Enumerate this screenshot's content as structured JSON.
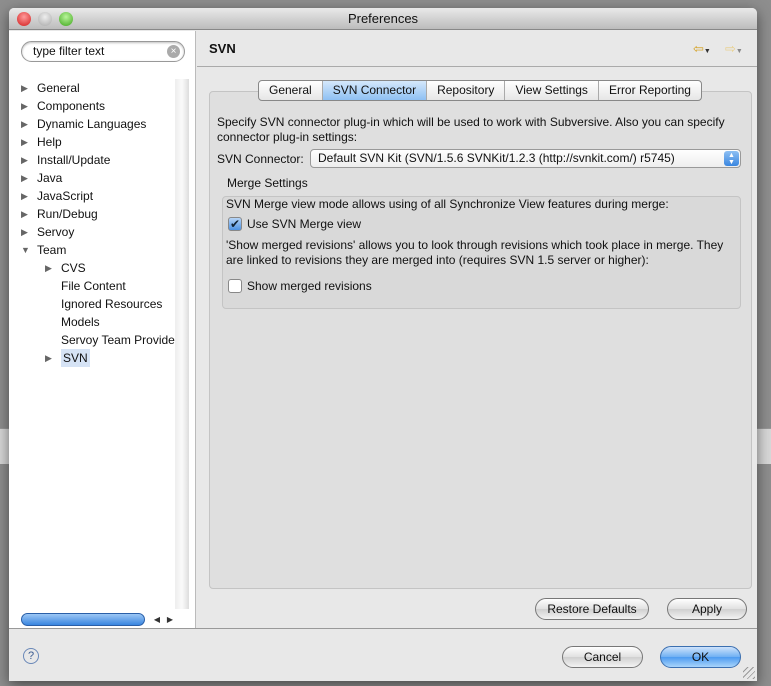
{
  "window": {
    "title": "Preferences"
  },
  "sidebar": {
    "search_placeholder": "type filter text",
    "items": [
      {
        "label": "General",
        "expandable": true
      },
      {
        "label": "Components",
        "expandable": true
      },
      {
        "label": "Dynamic Languages",
        "expandable": true
      },
      {
        "label": "Help",
        "expandable": true
      },
      {
        "label": "Install/Update",
        "expandable": true
      },
      {
        "label": "Java",
        "expandable": true
      },
      {
        "label": "JavaScript",
        "expandable": true
      },
      {
        "label": "Run/Debug",
        "expandable": true
      },
      {
        "label": "Servoy",
        "expandable": true
      },
      {
        "label": "Team",
        "expanded": true
      },
      {
        "label": "CVS",
        "expandable": true
      },
      {
        "label": "File Content"
      },
      {
        "label": "Ignored Resources"
      },
      {
        "label": "Models"
      },
      {
        "label": "Servoy Team Provider"
      },
      {
        "label": "SVN",
        "expandable": true,
        "selected": true
      }
    ]
  },
  "page": {
    "title": "SVN",
    "tabs": [
      "General",
      "SVN Connector",
      "Repository",
      "View Settings",
      "Error Reporting"
    ],
    "active_tab": "SVN Connector",
    "description": "Specify SVN connector plug-in which will be used to work with Subversive. Also you can specify connector plug-in settings:",
    "connector_label": "SVN Connector:",
    "connector_value": "Default SVN Kit (SVN/1.5.6 SVNKit/1.2.3 (http://svnkit.com/) r5745)",
    "merge": {
      "title": "Merge Settings",
      "desc1": "SVN Merge view mode allows using of all Synchronize View features during merge:",
      "use_merge_view": "Use SVN Merge view",
      "use_merge_view_checked": true,
      "desc2": "'Show merged revisions' allows you to look through revisions which took place in merge. They are linked to revisions they are merged into (requires SVN 1.5 server or higher):",
      "show_merged": "Show merged revisions",
      "show_merged_checked": false
    },
    "restore_defaults": "Restore Defaults",
    "apply": "Apply"
  },
  "footer": {
    "cancel": "Cancel",
    "ok": "OK",
    "help": "?"
  },
  "colors": {
    "accent": "#4d9bf0",
    "selection": "#d6e3f5"
  }
}
